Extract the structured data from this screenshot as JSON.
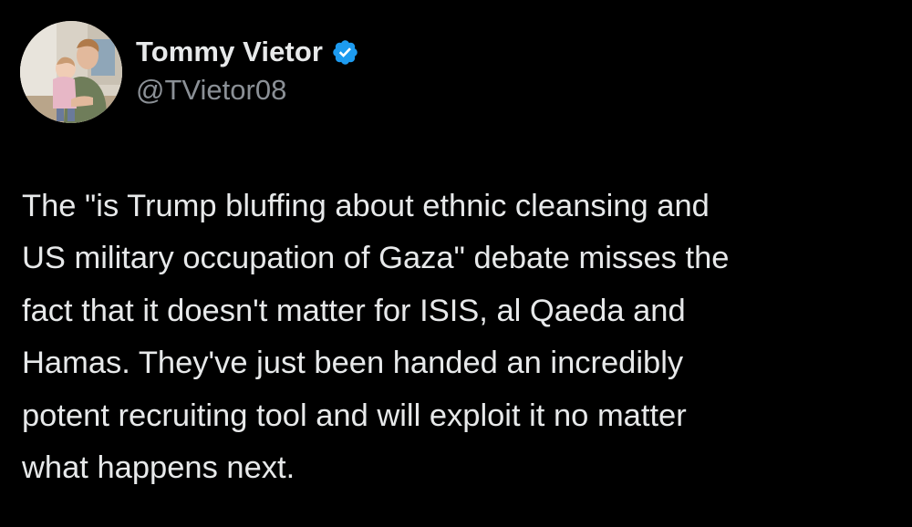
{
  "author": {
    "display_name": "Tommy Vietor",
    "handle": "@TVietor08",
    "verified": true,
    "verified_badge_color": "#1d9bf0"
  },
  "tweet": {
    "lines": [
      "The \"is Trump bluffing about ethnic cleansing and",
      "US military occupation of Gaza\" debate misses the",
      "fact that it doesn't matter for ISIS, al Qaeda and",
      "Hamas. They've just been handed an incredibly",
      "potent recruiting tool and will exploit it no matter",
      "what happens next."
    ]
  },
  "theme": {
    "background": "#000000",
    "text_primary": "#e7e9ea",
    "text_secondary": "#8b9096"
  },
  "icons": {
    "verified": "verified-badge-icon",
    "avatar": "profile-photo"
  }
}
